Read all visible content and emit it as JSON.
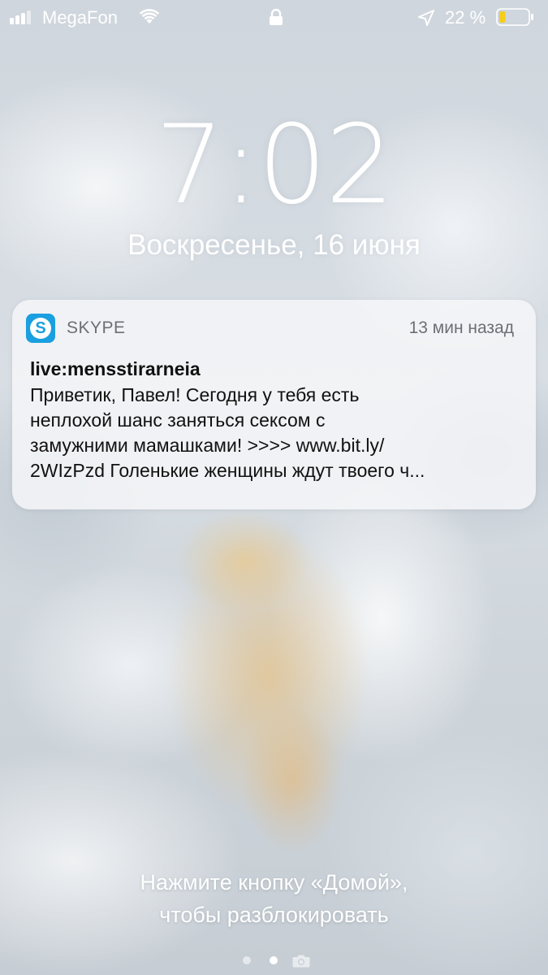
{
  "status_bar": {
    "carrier": "MegaFon",
    "signal_bars_active": 3,
    "signal_bars_total": 5,
    "battery_percent_label": "22 %",
    "battery_level": 0.22,
    "icons": [
      "signal-icon",
      "wifi-icon",
      "lock-icon",
      "location-icon",
      "battery-icon"
    ]
  },
  "lock_screen": {
    "time": "7:02",
    "date": "Воскресенье, 16 июня"
  },
  "notification": {
    "app_icon": "skype-icon",
    "app_name": "SKYPE",
    "time_ago": "13 мин назад",
    "sender": "live:mensstirarneia",
    "message_lines": [
      "Приветик, Павел! Сегодня у тебя есть",
      "неплохой шанс заняться сексом с",
      "замужними мамашками! >>>> www.bit.ly/",
      "2WIzPzd Голенькие женщины ждут твоего ч..."
    ]
  },
  "unlock_hint": {
    "line1": "Нажмите кнопку «Домой»,",
    "line2": "чтобы разблокировать"
  },
  "page_indicator": {
    "pages": 2,
    "active_index": 1,
    "trailing_icon": "camera-icon"
  },
  "colors": {
    "skype_blue": "#1a9fe0",
    "battery_low_yellow": "#f5cd1b"
  }
}
